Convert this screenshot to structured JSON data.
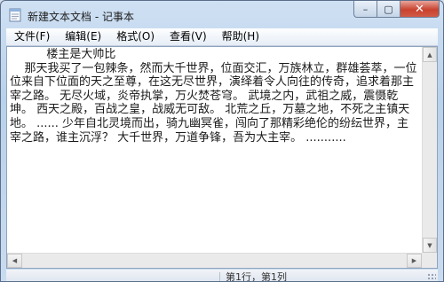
{
  "window": {
    "title": "新建文本文档 - 记事本"
  },
  "caption": {
    "minimize_icon": "minimize-icon",
    "maximize_icon": "maximize-icon",
    "close_icon": "close-icon",
    "minimize_glyph": "–",
    "maximize_glyph": "▢",
    "close_glyph": "✕"
  },
  "menu": {
    "items": [
      {
        "label": "文件(F)"
      },
      {
        "label": "编辑(E)"
      },
      {
        "label": "格式(O)"
      },
      {
        "label": "查看(V)"
      },
      {
        "label": "帮助(H)"
      }
    ]
  },
  "editor": {
    "content": "          楼主是大帅比\n    那天我买了一包辣条，然而大千世界，位面交汇，万族林立，群雄荟萃，一位位来自下位面的天之至尊，在这无尽世界，演绎着令人向往的传奇，追求着那主宰之路。 无尽火域，炎帝执掌，万火焚苍穹。 武境之内，武祖之威，震慑乾坤。 西天之殿，百战之皇，战威无可敌。 北荒之丘，万墓之地，不死之主镇天地。 ...... 少年自北灵境而出，骑九幽冥雀，闯向了那精彩绝伦的纷纭世界，主宰之路，谁主沉浮？ 大千世界，万道争锋，吾为大主宰。 ..........."
  },
  "statusbar": {
    "position_text": "第1行，第1列"
  },
  "colors": {
    "close_button": "#c8432f",
    "frame": "#b9d1ea"
  }
}
